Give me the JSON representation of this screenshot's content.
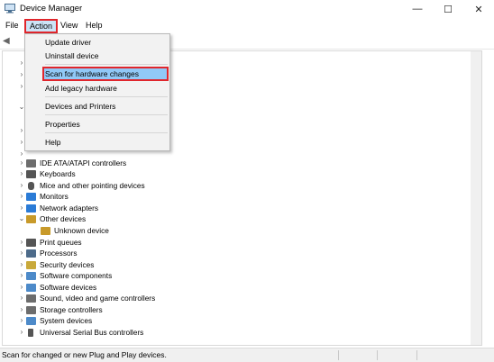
{
  "window": {
    "title": "Device Manager",
    "minimize": "—",
    "maximize": "☐",
    "close": "✕"
  },
  "menubar": {
    "items": [
      "File",
      "Action",
      "View",
      "Help"
    ]
  },
  "action_menu": {
    "items": [
      "Update driver",
      "Uninstall device",
      "Scan for hardware changes",
      "Add legacy hardware",
      "Devices and Printers",
      "Properties",
      "Help"
    ],
    "selected": "Scan for hardware changes"
  },
  "tree": {
    "rows": [
      {
        "label": "IDE ATA/ATAPI controllers",
        "icon": "ide-controller-icon",
        "color": "#6d6d6d"
      },
      {
        "label": "Keyboards",
        "icon": "keyboard-icon",
        "color": "#555555"
      },
      {
        "label": "Mice and other pointing devices",
        "icon": "mouse-icon",
        "color": "#555555"
      },
      {
        "label": "Monitors",
        "icon": "monitor-icon",
        "color": "#2b7bd6"
      },
      {
        "label": "Network adapters",
        "icon": "network-adapter-icon",
        "color": "#2b7bd6"
      },
      {
        "label": "Other devices",
        "icon": "other-devices-icon",
        "color": "#c89a2a"
      },
      {
        "label": "Unknown device",
        "icon": "unknown-device-icon",
        "color": "#c89a2a"
      },
      {
        "label": "Print queues",
        "icon": "printer-icon",
        "color": "#555555"
      },
      {
        "label": "Processors",
        "icon": "processor-icon",
        "color": "#4d6b8a"
      },
      {
        "label": "Security devices",
        "icon": "security-device-icon",
        "color": "#c9a93a"
      },
      {
        "label": "Software components",
        "icon": "software-component-icon",
        "color": "#4d8ac9"
      },
      {
        "label": "Software devices",
        "icon": "software-device-icon",
        "color": "#4d8ac9"
      },
      {
        "label": "Sound, video and game controllers",
        "icon": "sound-icon",
        "color": "#6d6d6d"
      },
      {
        "label": "Storage controllers",
        "icon": "storage-icon",
        "color": "#6d6d6d"
      },
      {
        "label": "System devices",
        "icon": "system-device-icon",
        "color": "#4d8ac9"
      },
      {
        "label": "Universal Serial Bus controllers",
        "icon": "usb-icon",
        "color": "#555555"
      }
    ]
  },
  "statusbar": {
    "text": "Scan for changed or new Plug and Play devices."
  },
  "colors": {
    "highlight_border": "#e0262c",
    "highlight_fill": "#91c9f7"
  }
}
